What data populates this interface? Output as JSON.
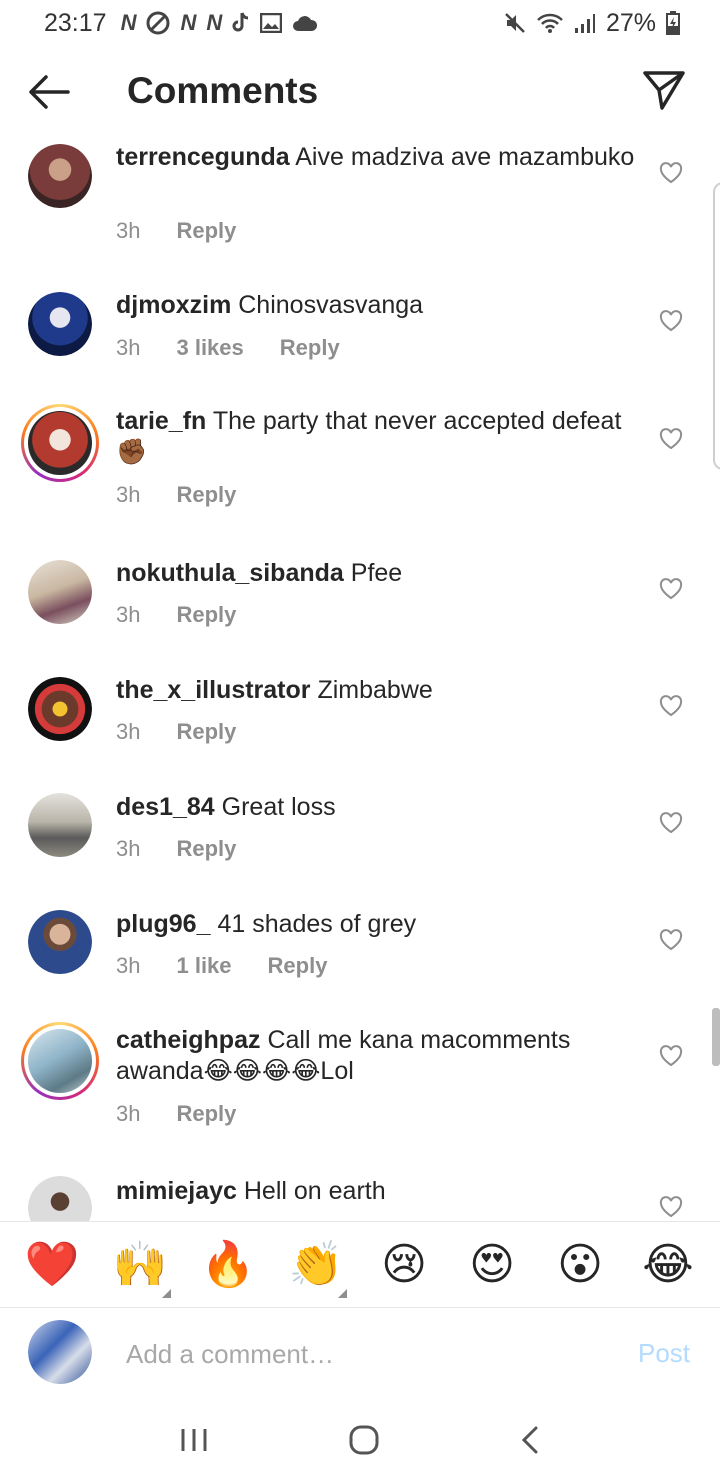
{
  "status_bar": {
    "time": "23:17",
    "left_icons": [
      "N",
      "N",
      "N"
    ],
    "battery": "27%"
  },
  "header": {
    "title": "Comments"
  },
  "comments": [
    {
      "username": "terrencegunda",
      "text": "Aive madziva ave mazambuko",
      "time": "3h",
      "likes": "",
      "reply": "Reply",
      "avatar_color": "#7a3b3b",
      "story": false
    },
    {
      "username": "djmoxzim",
      "text": "Chinosvasvanga",
      "time": "3h",
      "likes": "3 likes",
      "reply": "Reply",
      "avatar_color": "#1f3a8a",
      "story": false
    },
    {
      "username": "tarie_fn",
      "text": "The party that never accepted defeat ✊🏾",
      "time": "3h",
      "likes": "",
      "reply": "Reply",
      "avatar_color": "#b23a2e",
      "story": true
    },
    {
      "username": "nokuthula_sibanda",
      "text": "Pfee",
      "time": "3h",
      "likes": "",
      "reply": "Reply",
      "avatar_color": "#c9b7a1",
      "story": false
    },
    {
      "username": "the_x_illustrator",
      "text": "Zimbabwe",
      "time": "3h",
      "likes": "",
      "reply": "Reply",
      "avatar_color": "#d63b3b",
      "story": false
    },
    {
      "username": "des1_84",
      "text": "Great loss",
      "time": "3h",
      "likes": "",
      "reply": "Reply",
      "avatar_color": "#8d8a80",
      "story": false
    },
    {
      "username": "plug96_",
      "text": "41 shades of grey",
      "time": "3h",
      "likes": "1 like",
      "reply": "Reply",
      "avatar_color": "#2d4b8c",
      "story": false
    },
    {
      "username": "catheighpaz",
      "text": "Call me kana macomments awanda😂😂😂😂Lol",
      "time": "3h",
      "likes": "",
      "reply": "Reply",
      "avatar_color": "#8fb4c9",
      "story": true
    },
    {
      "username": "mimiejayc",
      "text": "Hell on earth",
      "time": "",
      "likes": "",
      "reply": "",
      "avatar_color": "#a9a9a9",
      "story": false
    }
  ],
  "emoji_bar": [
    "❤️",
    "🙌",
    "🔥",
    "👏",
    "😢",
    "😍",
    "😮",
    "😂"
  ],
  "input": {
    "placeholder": "Add a comment…",
    "post_label": "Post",
    "avatar_color": "#3a63b8"
  },
  "colors": {
    "text": "#262626",
    "meta": "#8e8e8e",
    "post_disabled": "#b3dbff"
  }
}
